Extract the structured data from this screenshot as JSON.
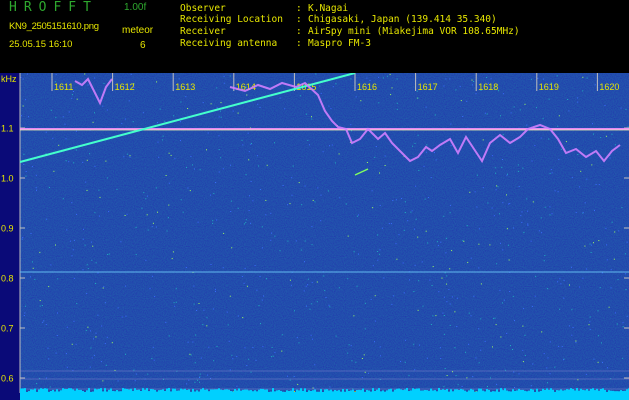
{
  "header": {
    "brand": "HROFFT",
    "version": "1.00f",
    "filename": "KN9_2505151610.png",
    "datetime": "25.05.15 16:10",
    "meteor_label": "meteor",
    "meteor_count": "6",
    "info": [
      {
        "label": "Observer",
        "value": "K.Nagai"
      },
      {
        "label": "Receiving Location",
        "value": "Chigasaki, Japan (139.414 35.340)"
      },
      {
        "label": "Receiver",
        "value": "AirSpy mini (Miakejima VOR 108.65MHz)"
      },
      {
        "label": "Receiving antenna",
        "value": "Maspro FM-3"
      }
    ]
  },
  "spectrogram": {
    "y_unit": "kHz",
    "y_ticks": [
      "1.1",
      "1.0",
      "0.9",
      "0.8",
      "0.7",
      "0.6"
    ],
    "time_ticks": [
      "1611",
      "1612",
      "1613",
      "1614",
      "1615",
      "1616",
      "1617",
      "1618",
      "1619",
      "1620"
    ],
    "colors": {
      "background": "#0a0a78",
      "axis": "#c0c0c0",
      "tick_label": "#e6e600",
      "carrier": "#ff90ff",
      "trail": "#44ffcc",
      "bottom_band": "#00d0ff"
    }
  }
}
